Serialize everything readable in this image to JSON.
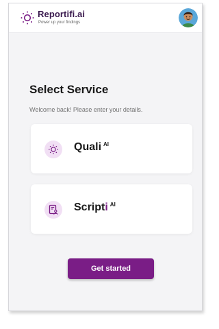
{
  "brand": {
    "name": "Reportifi.ai",
    "tagline": "Power up your findings",
    "icon": "sun-dots-icon",
    "color": "#3a1a4e"
  },
  "user": {
    "avatar": "user-avatar"
  },
  "page": {
    "title": "Select Service",
    "subtitle": "Welcome back! Please enter your details."
  },
  "services": [
    {
      "name": "Quali",
      "suffix": "AI",
      "icon": "sun-dots-icon"
    },
    {
      "name_prefix": "Script",
      "name_accent": "i",
      "suffix": "AI",
      "icon": "document-user-icon"
    }
  ],
  "cta": {
    "label": "Get started"
  },
  "colors": {
    "accent": "#7a1d86",
    "icon_bg": "#f1dff4",
    "page_bg": "#f4f4f6"
  }
}
